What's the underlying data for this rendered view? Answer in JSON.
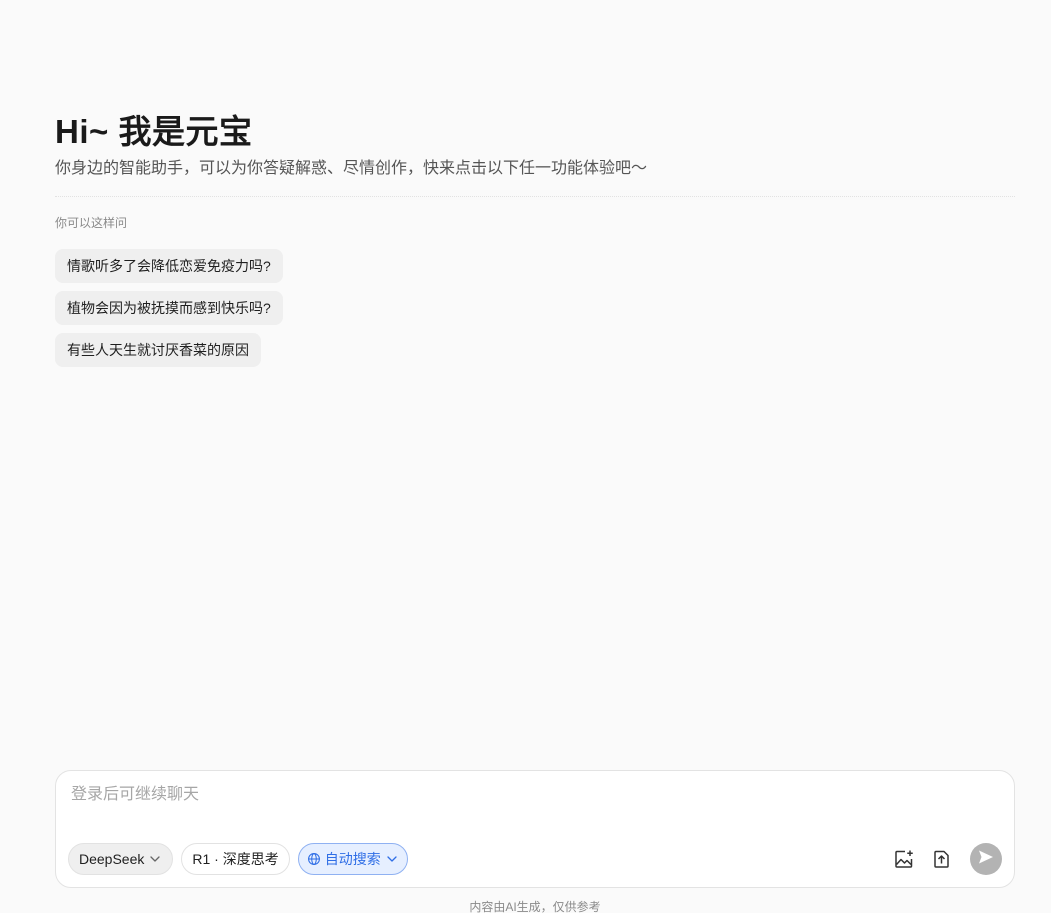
{
  "hero": {
    "title": "Hi~ 我是元宝",
    "subtitle": "你身边的智能助手，可以为你答疑解惑、尽情创作，快来点击以下任一功能体验吧～"
  },
  "suggestions": {
    "label": "你可以这样问",
    "items": [
      "情歌听多了会降低恋爱免疫力吗?",
      "植物会因为被抚摸而感到快乐吗?",
      "有些人天生就讨厌香菜的原因"
    ]
  },
  "composer": {
    "placeholder": "登录后可继续聊天",
    "model_label": "DeepSeek",
    "think_label": "R1 · 深度思考",
    "search_label": "自动搜索",
    "icons": [
      "image-upload-icon",
      "file-upload-icon",
      "send-icon"
    ]
  },
  "footer": {
    "note": "内容由AI生成，仅供参考"
  },
  "colors": {
    "background": "#fafafa",
    "accent": "#2f6ee6",
    "chip": "#efefef",
    "send_disabled": "#b3b3b3"
  }
}
